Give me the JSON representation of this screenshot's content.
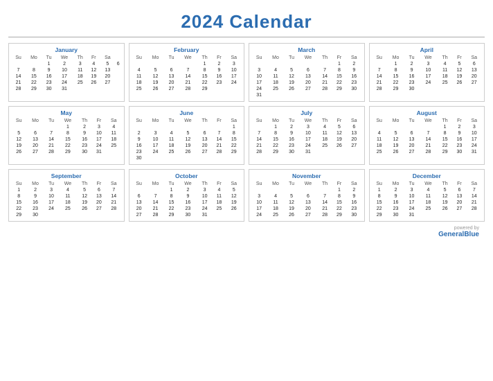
{
  "title": "2024 Calendar",
  "months": [
    {
      "name": "January",
      "days": [
        [
          "",
          "",
          "1",
          "2",
          "3",
          "4",
          "5",
          "6"
        ],
        [
          "7",
          "8",
          "9",
          "10",
          "11",
          "12",
          "13"
        ],
        [
          "14",
          "15",
          "16",
          "17",
          "18",
          "19",
          "20"
        ],
        [
          "21",
          "22",
          "23",
          "24",
          "25",
          "26",
          "27"
        ],
        [
          "28",
          "29",
          "30",
          "31",
          "",
          "",
          ""
        ]
      ]
    },
    {
      "name": "February",
      "days": [
        [
          "",
          "",
          "",
          "",
          "1",
          "2",
          "3"
        ],
        [
          "4",
          "5",
          "6",
          "7",
          "8",
          "9",
          "10"
        ],
        [
          "11",
          "12",
          "13",
          "14",
          "15",
          "16",
          "17"
        ],
        [
          "18",
          "19",
          "20",
          "21",
          "22",
          "23",
          "24"
        ],
        [
          "25",
          "26",
          "27",
          "28",
          "29",
          "",
          ""
        ]
      ]
    },
    {
      "name": "March",
      "days": [
        [
          "",
          "",
          "",
          "",
          "",
          "1",
          "2"
        ],
        [
          "3",
          "4",
          "5",
          "6",
          "7",
          "8",
          "9"
        ],
        [
          "10",
          "11",
          "12",
          "13",
          "14",
          "15",
          "16"
        ],
        [
          "17",
          "18",
          "19",
          "20",
          "21",
          "22",
          "23"
        ],
        [
          "24",
          "25",
          "26",
          "27",
          "28",
          "29",
          "30"
        ],
        [
          "31",
          "",
          "",
          "",
          "",
          "",
          ""
        ]
      ]
    },
    {
      "name": "April",
      "days": [
        [
          "",
          "1",
          "2",
          "3",
          "4",
          "5",
          "6"
        ],
        [
          "7",
          "8",
          "9",
          "10",
          "11",
          "12",
          "13"
        ],
        [
          "14",
          "15",
          "16",
          "17",
          "18",
          "19",
          "20"
        ],
        [
          "21",
          "22",
          "23",
          "24",
          "25",
          "26",
          "27"
        ],
        [
          "28",
          "29",
          "30",
          "",
          "",
          "",
          ""
        ]
      ]
    },
    {
      "name": "May",
      "days": [
        [
          "",
          "",
          "",
          "1",
          "2",
          "3",
          "4"
        ],
        [
          "5",
          "6",
          "7",
          "8",
          "9",
          "10",
          "11"
        ],
        [
          "12",
          "13",
          "14",
          "15",
          "16",
          "17",
          "18"
        ],
        [
          "19",
          "20",
          "21",
          "22",
          "23",
          "24",
          "25"
        ],
        [
          "26",
          "27",
          "28",
          "29",
          "30",
          "31",
          ""
        ]
      ]
    },
    {
      "name": "June",
      "days": [
        [
          "",
          "",
          "",
          "",
          "",
          "",
          "1"
        ],
        [
          "2",
          "3",
          "4",
          "5",
          "6",
          "7",
          "8"
        ],
        [
          "9",
          "10",
          "11",
          "12",
          "13",
          "14",
          "15"
        ],
        [
          "16",
          "17",
          "18",
          "19",
          "20",
          "21",
          "22"
        ],
        [
          "23",
          "24",
          "25",
          "26",
          "27",
          "28",
          "29"
        ],
        [
          "30",
          "",
          "",
          "",
          "",
          "",
          ""
        ]
      ]
    },
    {
      "name": "July",
      "days": [
        [
          "",
          "1",
          "2",
          "3",
          "4",
          "5",
          "6"
        ],
        [
          "7",
          "8",
          "9",
          "10",
          "11",
          "12",
          "13"
        ],
        [
          "14",
          "15",
          "16",
          "17",
          "18",
          "19",
          "20"
        ],
        [
          "21",
          "22",
          "23",
          "24",
          "25",
          "26",
          "27"
        ],
        [
          "28",
          "29",
          "30",
          "31",
          "",
          "",
          ""
        ]
      ]
    },
    {
      "name": "August",
      "days": [
        [
          "",
          "",
          "",
          "",
          "1",
          "2",
          "3"
        ],
        [
          "4",
          "5",
          "6",
          "7",
          "8",
          "9",
          "10"
        ],
        [
          "11",
          "12",
          "13",
          "14",
          "15",
          "16",
          "17"
        ],
        [
          "18",
          "19",
          "20",
          "21",
          "22",
          "23",
          "24"
        ],
        [
          "25",
          "26",
          "27",
          "28",
          "29",
          "30",
          "31"
        ]
      ]
    },
    {
      "name": "September",
      "days": [
        [
          "1",
          "2",
          "3",
          "4",
          "5",
          "6",
          "7"
        ],
        [
          "8",
          "9",
          "10",
          "11",
          "12",
          "13",
          "14"
        ],
        [
          "15",
          "16",
          "17",
          "18",
          "19",
          "20",
          "21"
        ],
        [
          "22",
          "23",
          "24",
          "25",
          "26",
          "27",
          "28"
        ],
        [
          "29",
          "30",
          "",
          "",
          "",
          "",
          ""
        ]
      ]
    },
    {
      "name": "October",
      "days": [
        [
          "",
          "",
          "1",
          "2",
          "3",
          "4",
          "5"
        ],
        [
          "6",
          "7",
          "8",
          "9",
          "10",
          "11",
          "12"
        ],
        [
          "13",
          "14",
          "15",
          "16",
          "17",
          "18",
          "19"
        ],
        [
          "20",
          "21",
          "22",
          "23",
          "24",
          "25",
          "26"
        ],
        [
          "27",
          "28",
          "29",
          "30",
          "31",
          "",
          ""
        ]
      ]
    },
    {
      "name": "November",
      "days": [
        [
          "",
          "",
          "",
          "",
          "",
          "1",
          "2"
        ],
        [
          "3",
          "4",
          "5",
          "6",
          "7",
          "8",
          "9"
        ],
        [
          "10",
          "11",
          "12",
          "13",
          "14",
          "15",
          "16"
        ],
        [
          "17",
          "18",
          "19",
          "20",
          "21",
          "22",
          "23"
        ],
        [
          "24",
          "25",
          "26",
          "27",
          "28",
          "29",
          "30"
        ]
      ]
    },
    {
      "name": "December",
      "days": [
        [
          "1",
          "2",
          "3",
          "4",
          "5",
          "6",
          "7"
        ],
        [
          "8",
          "9",
          "10",
          "11",
          "12",
          "13",
          "14"
        ],
        [
          "15",
          "16",
          "17",
          "18",
          "19",
          "20",
          "21"
        ],
        [
          "22",
          "23",
          "24",
          "25",
          "26",
          "27",
          "28"
        ],
        [
          "29",
          "30",
          "31",
          "",
          "",
          "",
          ""
        ]
      ]
    }
  ],
  "dayHeaders": [
    "Su",
    "Mo",
    "Tu",
    "We",
    "Th",
    "Fr",
    "Sa"
  ],
  "footer": {
    "powered": "powered by",
    "brand": "GeneralBlue"
  }
}
